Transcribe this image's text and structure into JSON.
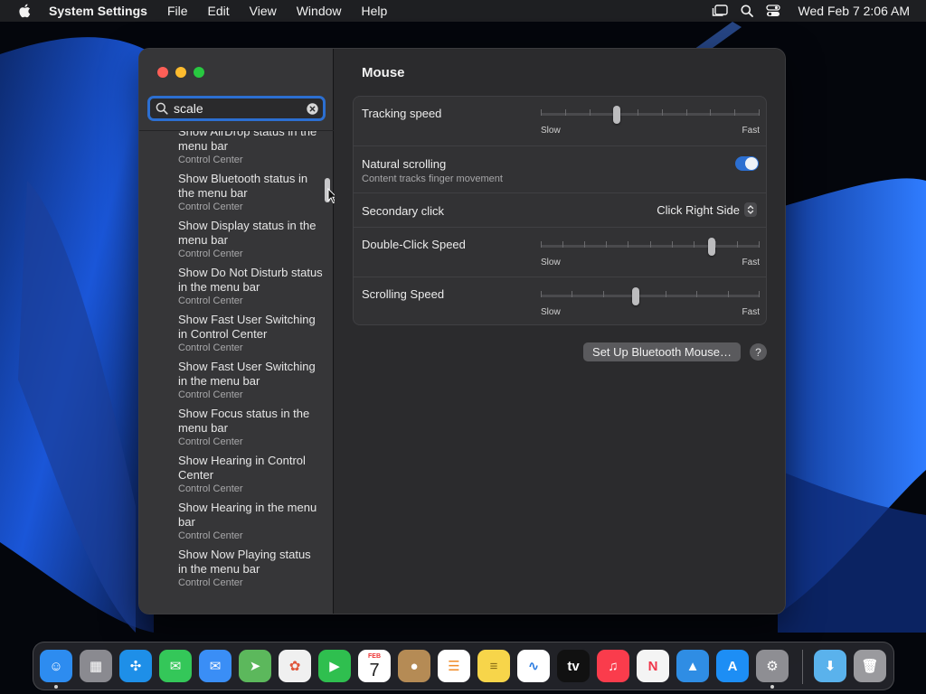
{
  "menubar": {
    "app_name": "System Settings",
    "items": [
      "File",
      "Edit",
      "View",
      "Window",
      "Help"
    ],
    "clock": "Wed Feb 7  2:06 AM"
  },
  "sidebar": {
    "search": {
      "value": "scale"
    },
    "results": [
      {
        "title": "Show AirDrop status in the menu bar",
        "subtitle": "Control Center"
      },
      {
        "title": "Show Bluetooth status in the menu bar",
        "subtitle": "Control Center"
      },
      {
        "title": "Show Display status in the menu bar",
        "subtitle": "Control Center"
      },
      {
        "title": "Show Do Not Disturb status in the menu bar",
        "subtitle": "Control Center"
      },
      {
        "title": "Show Fast User Switching in Control Center",
        "subtitle": "Control Center"
      },
      {
        "title": "Show Fast User Switching in the menu bar",
        "subtitle": "Control Center"
      },
      {
        "title": "Show Focus status in the menu bar",
        "subtitle": "Control Center"
      },
      {
        "title": "Show Hearing in Control Center",
        "subtitle": "Control Center"
      },
      {
        "title": "Show Hearing in the menu bar",
        "subtitle": "Control Center"
      },
      {
        "title": "Show Now Playing status in the menu bar",
        "subtitle": "Control Center"
      }
    ]
  },
  "mouse": {
    "title": "Mouse",
    "tracking_speed": {
      "label": "Tracking speed",
      "min_label": "Slow",
      "max_label": "Fast",
      "level": 0.34
    },
    "natural_scrolling": {
      "label": "Natural scrolling",
      "description": "Content tracks finger movement",
      "enabled": true
    },
    "secondary_click": {
      "label": "Secondary click",
      "value": "Click Right Side"
    },
    "double_click_speed": {
      "label": "Double-Click Speed",
      "min_label": "Slow",
      "max_label": "Fast",
      "level": 0.79
    },
    "scrolling_speed": {
      "label": "Scrolling Speed",
      "min_label": "Slow",
      "max_label": "Fast",
      "level": 0.43
    },
    "setup_button": "Set Up Bluetooth Mouse…",
    "help_button": "?"
  },
  "dock": {
    "apps": [
      {
        "icon": "finder-icon",
        "color": "#2d8cf0",
        "running": true
      },
      {
        "icon": "launchpad-icon",
        "color": "#8a8a90",
        "running": false
      },
      {
        "icon": "safari-icon",
        "color": "#1e8fe8",
        "running": false
      },
      {
        "icon": "messages-icon",
        "color": "#34c759",
        "running": false
      },
      {
        "icon": "mail-icon",
        "color": "#3a8ef6",
        "running": false
      },
      {
        "icon": "maps-icon",
        "color": "#5cb85c",
        "running": false
      },
      {
        "icon": "photos-icon",
        "color": "#f0f0f0",
        "running": false
      },
      {
        "icon": "facetime-icon",
        "color": "#2fbf4f",
        "running": false
      },
      {
        "icon": "calendar-icon",
        "color": "#ffffff",
        "running": false,
        "month": "FEB",
        "day": "7"
      },
      {
        "icon": "contacts-icon",
        "color": "#b58b55",
        "running": false
      },
      {
        "icon": "reminders-icon",
        "color": "#ffffff",
        "running": false
      },
      {
        "icon": "notes-icon",
        "color": "#f7d54a",
        "running": false
      },
      {
        "icon": "freeform-icon",
        "color": "#ffffff",
        "running": false
      },
      {
        "icon": "tv-icon",
        "color": "#111111",
        "running": false,
        "text": "tv"
      },
      {
        "icon": "music-icon",
        "color": "#fa3c4c",
        "running": false
      },
      {
        "icon": "news-icon",
        "color": "#f4f4f4",
        "running": false
      },
      {
        "icon": "keynote-icon",
        "color": "#2f8de4",
        "running": false
      },
      {
        "icon": "app-store-icon",
        "color": "#1d8ef5",
        "running": false
      },
      {
        "icon": "system-settings-icon",
        "color": "#8e8e93",
        "running": true
      },
      {
        "icon": "downloads-folder-icon",
        "color": "#5ab2ec",
        "running": false
      },
      {
        "icon": "trash-icon",
        "color": "#9a9a9e",
        "running": false
      }
    ]
  }
}
